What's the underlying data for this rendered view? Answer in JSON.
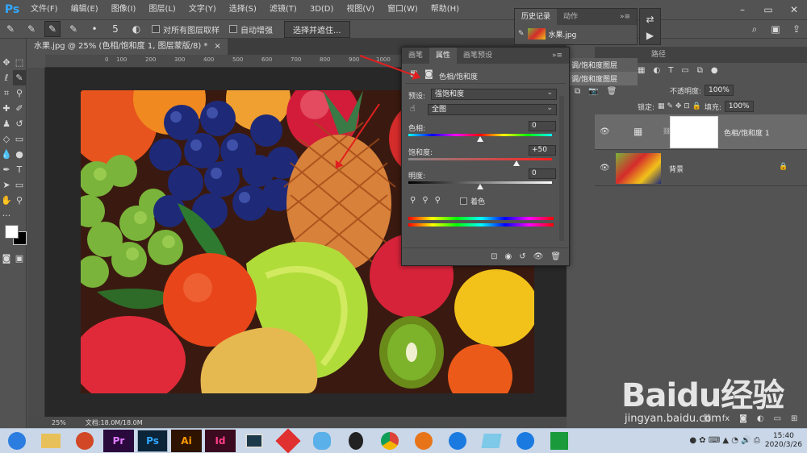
{
  "app": {
    "logo": "Ps"
  },
  "menu": [
    "文件(F)",
    "编辑(E)",
    "图像(I)",
    "图层(L)",
    "文字(Y)",
    "选择(S)",
    "滤镜(T)",
    "3D(D)",
    "视图(V)",
    "窗口(W)",
    "帮助(H)"
  ],
  "options": {
    "brush_size": "5",
    "sample_all_label": "对所有图层取样",
    "auto_enhance_label": "自动增强",
    "select_mask_button": "选择并遮住..."
  },
  "document": {
    "tab_title": "水果.jpg @ 25% (色相/饱和度 1, 图层蒙版/8) *",
    "close": "×",
    "zoom": "25%",
    "doc_size": "文档:18.0M/18.0M",
    "ruler_ticks": [
      "0",
      "100",
      "200",
      "300",
      "400",
      "500",
      "600",
      "700",
      "800",
      "900",
      "1000"
    ]
  },
  "history": {
    "tabs": [
      "历史记录",
      "动作"
    ],
    "items": [
      "水果.jpg"
    ],
    "behind_items": [
      "调/饱和度图层",
      "调/饱和度图层"
    ]
  },
  "properties": {
    "tabs": [
      "画笔",
      "属性",
      "画笔预设"
    ],
    "header": "色相/饱和度",
    "preset_label": "预设:",
    "preset_value": "强饱和度",
    "channel_value": "全图",
    "hue_label": "色相:",
    "hue_value": "0",
    "hue": 0,
    "saturation_label": "饱和度:",
    "saturation_value": "+50",
    "saturation": 50,
    "lightness_label": "明度:",
    "lightness_value": "0",
    "lightness": 0,
    "colorize_label": "着色"
  },
  "layers": {
    "tabs_visible": [
      "路径"
    ],
    "opacity_label": "不透明度:",
    "opacity_value": "100%",
    "fill_label": "填充:",
    "fill_value": "100%",
    "lock_label": "锁定:",
    "items": [
      {
        "name": "色相/饱和度 1",
        "selected": true
      },
      {
        "name": "背景",
        "selected": false
      }
    ]
  },
  "taskbar": {
    "apps": [
      {
        "label": "Pr",
        "color": "#2a0a3d",
        "text": "#e07bff"
      },
      {
        "label": "Ps",
        "color": "#0b2438",
        "text": "#31a8ff"
      },
      {
        "label": "Ai",
        "color": "#2d1300",
        "text": "#ff9a00"
      },
      {
        "label": "Id",
        "color": "#3a0a1e",
        "text": "#ff3d8b"
      }
    ],
    "time": "15:40",
    "date": "2020/3/26"
  },
  "watermark": {
    "brand": "Baidu经验",
    "url": "jingyan.baidu.com"
  }
}
